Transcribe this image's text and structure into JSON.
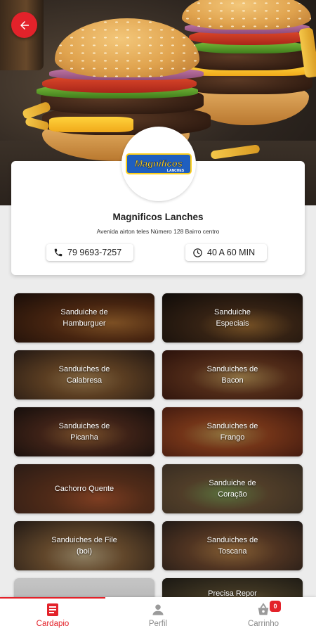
{
  "store": {
    "name": "Magnificos Lanches",
    "address": "Avenida airton teles Número 128 Bairro centro",
    "phone": "79 9693-7257",
    "delivery_time": "40 A 60 MIN",
    "logo_text": "Magnificos",
    "logo_sub": "LANCHES"
  },
  "categories": [
    {
      "line1": "Sanduiche de",
      "line2": "Hamburguer"
    },
    {
      "line1": "Sanduiche",
      "line2": "Especiais"
    },
    {
      "line1": "Sanduiches de",
      "line2": "Calabresa"
    },
    {
      "line1": "Sanduiches de",
      "line2": "Bacon"
    },
    {
      "line1": "Sanduiches de",
      "line2": "Picanha"
    },
    {
      "line1": "Sanduiches de",
      "line2": "Frango"
    },
    {
      "line1": "Cachorro Quente",
      "line2": ""
    },
    {
      "line1": "Sanduiche de",
      "line2": "Coração"
    },
    {
      "line1": "Sanduiches de File",
      "line2": "(boi)"
    },
    {
      "line1": "Sanduiches de",
      "line2": "Toscana"
    },
    {
      "line1": "",
      "line2": ""
    },
    {
      "line1": "Precisa Repor",
      "line2": ""
    }
  ],
  "nav": {
    "items": [
      {
        "label": "Cardapio",
        "icon": "menu-list-icon"
      },
      {
        "label": "Perfil",
        "icon": "person-icon"
      },
      {
        "label": "Carrinho",
        "icon": "basket-icon"
      }
    ],
    "cart_count": "0"
  },
  "colors": {
    "accent": "#e3222a",
    "inactive": "#8a8a8a"
  }
}
